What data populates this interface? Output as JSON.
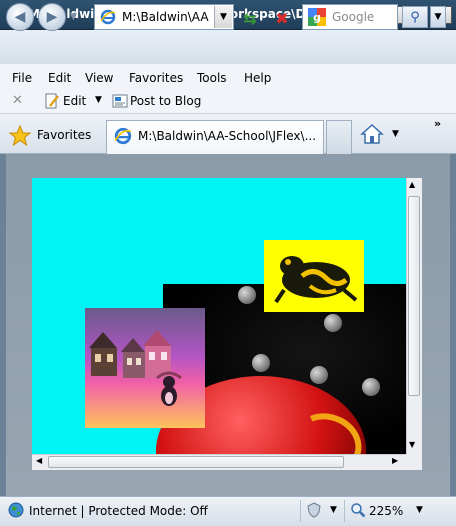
{
  "window": {
    "title": "M:\\Baldwin\\AA-School\\JFlex\\Workspace\\DragAndD...",
    "minimize": "_",
    "maximize": "□",
    "close": "✕"
  },
  "address_bar": {
    "url": "M:\\Baldwin\\AA",
    "search_placeholder": "Google"
  },
  "menu": {
    "items": [
      "File",
      "Edit",
      "View",
      "Favorites",
      "Tools",
      "Help"
    ]
  },
  "command_bar": {
    "edit_label": "Edit",
    "blog_label": "Post to Blog"
  },
  "favorites_bar": {
    "favorites_label": "Favorites",
    "tab_title": "M:\\Baldwin\\AA-School\\JFlex\\..."
  },
  "status_bar": {
    "zone_text": "Internet | Protected Mode: Off",
    "zoom": "225%"
  },
  "colors": {
    "canvas_background": "#00f4f4",
    "title_bar": "#2f5371",
    "frog_background": "#ffff00"
  },
  "icons": {
    "back": "arrow-left-icon",
    "forward": "arrow-right-icon",
    "refresh": "refresh-icon",
    "stop": "stop-icon",
    "search": "search-icon",
    "favorites": "star-icon",
    "home": "home-icon",
    "zone": "globe-icon",
    "zoom": "zoom-icon"
  }
}
